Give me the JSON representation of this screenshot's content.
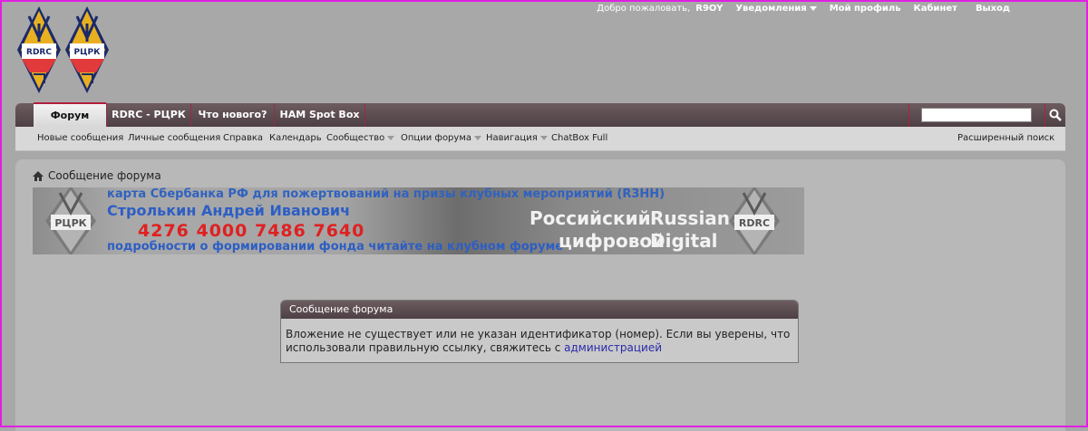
{
  "userbar": {
    "welcome": "Добро пожаловать,",
    "username": "R9OY",
    "notifications": "Уведомления",
    "profile": "Мой профиль",
    "cabinet": "Кабинет",
    "logout": "Выход"
  },
  "logos": {
    "left": "RDRC",
    "right": "РЦРК"
  },
  "navbar": {
    "tabs": [
      {
        "label": "Форум",
        "active": true
      },
      {
        "label": "RDRC - РЦРК"
      },
      {
        "label": "Что нового?"
      },
      {
        "label": "HAM Spot Box"
      }
    ],
    "search_placeholder": ""
  },
  "subnav": {
    "items": [
      {
        "label": "Новые сообщения"
      },
      {
        "label": "Личные сообщения"
      },
      {
        "label": "Справка"
      },
      {
        "label": "Календарь"
      },
      {
        "label": "Сообщество",
        "dropdown": true
      },
      {
        "label": "Опции форума",
        "dropdown": true
      },
      {
        "label": "Навигация",
        "dropdown": true
      },
      {
        "label": "ChatBox Full"
      }
    ],
    "advanced_search": "Расширенный поиск"
  },
  "breadcrumb": "Сообщение форума",
  "banner": {
    "line1": "карта Сбербанка РФ для пожертвований на призы клубных мероприятий (R3HH)",
    "line2": "Стролькин Андрей Иванович",
    "line3": "4276 4000 7486 7640",
    "line4": "подробности о формировании фонда читайте на клубном форуме",
    "ru1": "Российский",
    "ru2": "цифровой",
    "en1": "Russian",
    "en2": "Digital",
    "logo_left": "РЦРК",
    "logo_right": "RDRC"
  },
  "message": {
    "title": "Сообщение форума",
    "text": "Вложение не существует или не указан идентификатор (номер). Если вы уверены, что использовали правильную ссылку, свяжитесь с ",
    "link": "администрацией"
  },
  "colors": {
    "background": "#a8a8a8",
    "navbar": "#5a4a4e",
    "accent": "#b0203e",
    "frame": "#e020e0",
    "link": "#2a2aaa"
  }
}
